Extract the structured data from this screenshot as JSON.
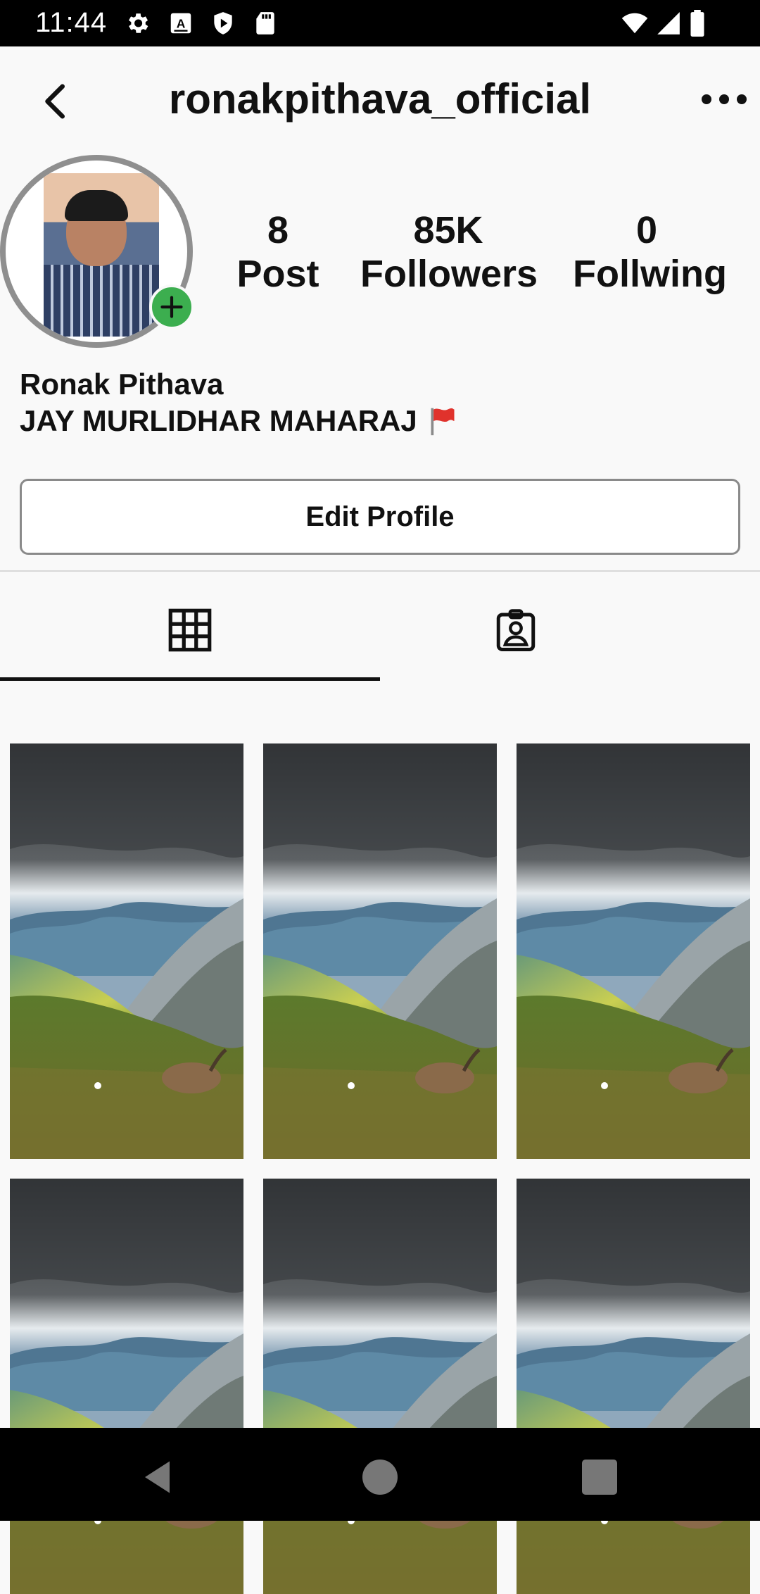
{
  "status_bar": {
    "time": "11:44",
    "icons": [
      "gear-icon",
      "a-icon",
      "shield-play-icon",
      "sd-card-icon",
      "wifi-icon",
      "signal-icon",
      "battery-icon"
    ]
  },
  "app_bar": {
    "title": "ronakpithava_official",
    "back_icon": "back-arrow-icon",
    "more_icon": "more-horizontal-icon"
  },
  "profile": {
    "stats": [
      {
        "value": "8",
        "label": "Post"
      },
      {
        "value": "85K",
        "label": "Followers"
      },
      {
        "value": "0",
        "label": "Follwing"
      }
    ],
    "name": "Ronak Pithava",
    "bio": "JAY MURLIDHAR MAHARAJ",
    "bio_emoji": "red-flag-emoji",
    "edit_button": "Edit Profile",
    "add_story_icon": "plus-icon",
    "add_story_color": "#3cae4f"
  },
  "tabs": [
    {
      "icon": "grid-icon",
      "active": true
    },
    {
      "icon": "tagged-profile-icon",
      "active": false
    }
  ],
  "posts": [
    {
      "image": "mountain-landscape-with-ibex"
    },
    {
      "image": "mountain-landscape-with-ibex"
    },
    {
      "image": "mountain-landscape-with-ibex"
    },
    {
      "image": "mountain-landscape-with-ibex"
    },
    {
      "image": "mountain-landscape-with-ibex"
    },
    {
      "image": "mountain-landscape-with-ibex"
    }
  ],
  "nav_bar": {
    "icons": [
      "back-triangle-icon",
      "home-circle-icon",
      "recents-square-icon"
    ]
  }
}
